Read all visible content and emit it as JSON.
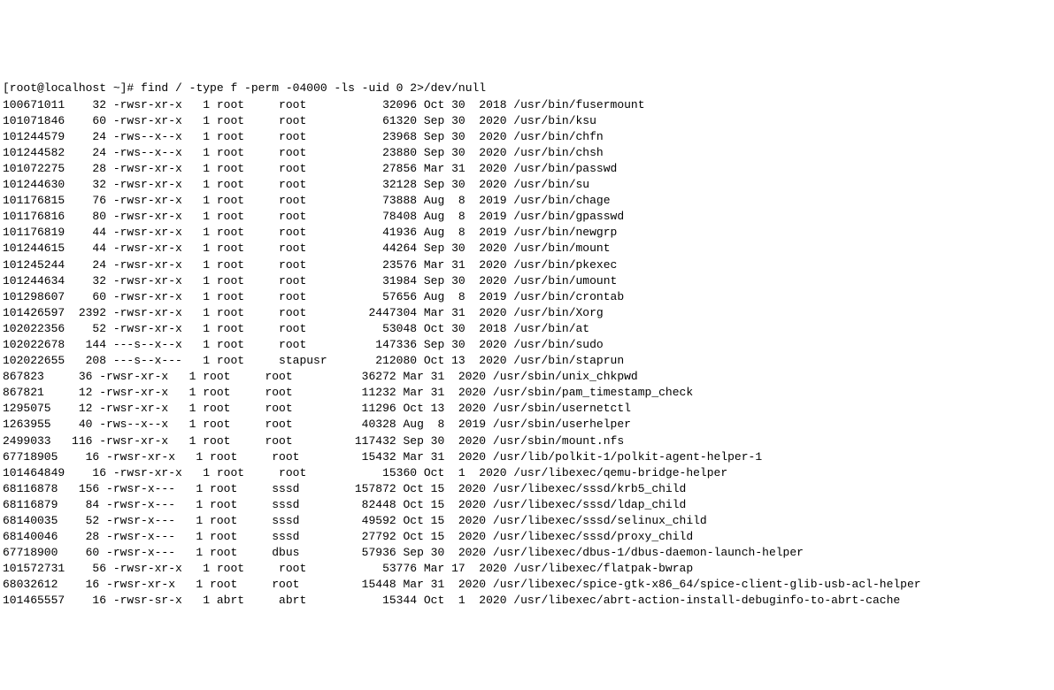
{
  "prompt": "[root@localhost ~]# ",
  "command": "find / -type f -perm -04000 -ls -uid 0 2>/dev/null",
  "rows": [
    {
      "inode": "100671011",
      "blocks": "32",
      "perm": "-rwsr-xr-x",
      "links": "1",
      "user": "root",
      "group": "root",
      "size": "32096",
      "month": "Oct",
      "day": "30",
      "year": "2018",
      "path": "/usr/bin/fusermount"
    },
    {
      "inode": "101071846",
      "blocks": "60",
      "perm": "-rwsr-xr-x",
      "links": "1",
      "user": "root",
      "group": "root",
      "size": "61320",
      "month": "Sep",
      "day": "30",
      "year": "2020",
      "path": "/usr/bin/ksu"
    },
    {
      "inode": "101244579",
      "blocks": "24",
      "perm": "-rws--x--x",
      "links": "1",
      "user": "root",
      "group": "root",
      "size": "23968",
      "month": "Sep",
      "day": "30",
      "year": "2020",
      "path": "/usr/bin/chfn"
    },
    {
      "inode": "101244582",
      "blocks": "24",
      "perm": "-rws--x--x",
      "links": "1",
      "user": "root",
      "group": "root",
      "size": "23880",
      "month": "Sep",
      "day": "30",
      "year": "2020",
      "path": "/usr/bin/chsh"
    },
    {
      "inode": "101072275",
      "blocks": "28",
      "perm": "-rwsr-xr-x",
      "links": "1",
      "user": "root",
      "group": "root",
      "size": "27856",
      "month": "Mar",
      "day": "31",
      "year": "2020",
      "path": "/usr/bin/passwd"
    },
    {
      "inode": "101244630",
      "blocks": "32",
      "perm": "-rwsr-xr-x",
      "links": "1",
      "user": "root",
      "group": "root",
      "size": "32128",
      "month": "Sep",
      "day": "30",
      "year": "2020",
      "path": "/usr/bin/su"
    },
    {
      "inode": "101176815",
      "blocks": "76",
      "perm": "-rwsr-xr-x",
      "links": "1",
      "user": "root",
      "group": "root",
      "size": "73888",
      "month": "Aug",
      "day": "8",
      "year": "2019",
      "path": "/usr/bin/chage"
    },
    {
      "inode": "101176816",
      "blocks": "80",
      "perm": "-rwsr-xr-x",
      "links": "1",
      "user": "root",
      "group": "root",
      "size": "78408",
      "month": "Aug",
      "day": "8",
      "year": "2019",
      "path": "/usr/bin/gpasswd"
    },
    {
      "inode": "101176819",
      "blocks": "44",
      "perm": "-rwsr-xr-x",
      "links": "1",
      "user": "root",
      "group": "root",
      "size": "41936",
      "month": "Aug",
      "day": "8",
      "year": "2019",
      "path": "/usr/bin/newgrp"
    },
    {
      "inode": "101244615",
      "blocks": "44",
      "perm": "-rwsr-xr-x",
      "links": "1",
      "user": "root",
      "group": "root",
      "size": "44264",
      "month": "Sep",
      "day": "30",
      "year": "2020",
      "path": "/usr/bin/mount"
    },
    {
      "inode": "101245244",
      "blocks": "24",
      "perm": "-rwsr-xr-x",
      "links": "1",
      "user": "root",
      "group": "root",
      "size": "23576",
      "month": "Mar",
      "day": "31",
      "year": "2020",
      "path": "/usr/bin/pkexec"
    },
    {
      "inode": "101244634",
      "blocks": "32",
      "perm": "-rwsr-xr-x",
      "links": "1",
      "user": "root",
      "group": "root",
      "size": "31984",
      "month": "Sep",
      "day": "30",
      "year": "2020",
      "path": "/usr/bin/umount"
    },
    {
      "inode": "101298607",
      "blocks": "60",
      "perm": "-rwsr-xr-x",
      "links": "1",
      "user": "root",
      "group": "root",
      "size": "57656",
      "month": "Aug",
      "day": "8",
      "year": "2019",
      "path": "/usr/bin/crontab"
    },
    {
      "inode": "101426597",
      "blocks": "2392",
      "perm": "-rwsr-xr-x",
      "links": "1",
      "user": "root",
      "group": "root",
      "size": "2447304",
      "month": "Mar",
      "day": "31",
      "year": "2020",
      "path": "/usr/bin/Xorg"
    },
    {
      "inode": "102022356",
      "blocks": "52",
      "perm": "-rwsr-xr-x",
      "links": "1",
      "user": "root",
      "group": "root",
      "size": "53048",
      "month": "Oct",
      "day": "30",
      "year": "2018",
      "path": "/usr/bin/at"
    },
    {
      "inode": "102022678",
      "blocks": "144",
      "perm": "---s--x--x",
      "links": "1",
      "user": "root",
      "group": "root",
      "size": "147336",
      "month": "Sep",
      "day": "30",
      "year": "2020",
      "path": "/usr/bin/sudo"
    },
    {
      "inode": "102022655",
      "blocks": "208",
      "perm": "---s--x---",
      "links": "1",
      "user": "root",
      "group": "stapusr",
      "size": "212080",
      "month": "Oct",
      "day": "13",
      "year": "2020",
      "path": "/usr/bin/staprun"
    },
    {
      "inode": "867823",
      "blocks": "36",
      "perm": "-rwsr-xr-x",
      "links": "1",
      "user": "root",
      "group": "root",
      "size": "36272",
      "month": "Mar",
      "day": "31",
      "year": "2020",
      "path": "/usr/sbin/unix_chkpwd"
    },
    {
      "inode": "867821",
      "blocks": "12",
      "perm": "-rwsr-xr-x",
      "links": "1",
      "user": "root",
      "group": "root",
      "size": "11232",
      "month": "Mar",
      "day": "31",
      "year": "2020",
      "path": "/usr/sbin/pam_timestamp_check"
    },
    {
      "inode": "1295075",
      "blocks": "12",
      "perm": "-rwsr-xr-x",
      "links": "1",
      "user": "root",
      "group": "root",
      "size": "11296",
      "month": "Oct",
      "day": "13",
      "year": "2020",
      "path": "/usr/sbin/usernetctl"
    },
    {
      "inode": "1263955",
      "blocks": "40",
      "perm": "-rws--x--x",
      "links": "1",
      "user": "root",
      "group": "root",
      "size": "40328",
      "month": "Aug",
      "day": "8",
      "year": "2019",
      "path": "/usr/sbin/userhelper"
    },
    {
      "inode": "2499033",
      "blocks": "116",
      "perm": "-rwsr-xr-x",
      "links": "1",
      "user": "root",
      "group": "root",
      "size": "117432",
      "month": "Sep",
      "day": "30",
      "year": "2020",
      "path": "/usr/sbin/mount.nfs"
    },
    {
      "inode": "67718905",
      "blocks": "16",
      "perm": "-rwsr-xr-x",
      "links": "1",
      "user": "root",
      "group": "root",
      "size": "15432",
      "month": "Mar",
      "day": "31",
      "year": "2020",
      "path": "/usr/lib/polkit-1/polkit-agent-helper-1"
    },
    {
      "inode": "101464849",
      "blocks": "16",
      "perm": "-rwsr-xr-x",
      "links": "1",
      "user": "root",
      "group": "root",
      "size": "15360",
      "month": "Oct",
      "day": "1",
      "year": "2020",
      "path": "/usr/libexec/qemu-bridge-helper"
    },
    {
      "inode": "68116878",
      "blocks": "156",
      "perm": "-rwsr-x---",
      "links": "1",
      "user": "root",
      "group": "sssd",
      "size": "157872",
      "month": "Oct",
      "day": "15",
      "year": "2020",
      "path": "/usr/libexec/sssd/krb5_child"
    },
    {
      "inode": "68116879",
      "blocks": "84",
      "perm": "-rwsr-x---",
      "links": "1",
      "user": "root",
      "group": "sssd",
      "size": "82448",
      "month": "Oct",
      "day": "15",
      "year": "2020",
      "path": "/usr/libexec/sssd/ldap_child"
    },
    {
      "inode": "68140035",
      "blocks": "52",
      "perm": "-rwsr-x---",
      "links": "1",
      "user": "root",
      "group": "sssd",
      "size": "49592",
      "month": "Oct",
      "day": "15",
      "year": "2020",
      "path": "/usr/libexec/sssd/selinux_child"
    },
    {
      "inode": "68140046",
      "blocks": "28",
      "perm": "-rwsr-x---",
      "links": "1",
      "user": "root",
      "group": "sssd",
      "size": "27792",
      "month": "Oct",
      "day": "15",
      "year": "2020",
      "path": "/usr/libexec/sssd/proxy_child"
    },
    {
      "inode": "67718900",
      "blocks": "60",
      "perm": "-rwsr-x---",
      "links": "1",
      "user": "root",
      "group": "dbus",
      "size": "57936",
      "month": "Sep",
      "day": "30",
      "year": "2020",
      "path": "/usr/libexec/dbus-1/dbus-daemon-launch-helper"
    },
    {
      "inode": "101572731",
      "blocks": "56",
      "perm": "-rwsr-xr-x",
      "links": "1",
      "user": "root",
      "group": "root",
      "size": "53776",
      "month": "Mar",
      "day": "17",
      "year": "2020",
      "path": "/usr/libexec/flatpak-bwrap"
    },
    {
      "inode": "68032612",
      "blocks": "16",
      "perm": "-rwsr-xr-x",
      "links": "1",
      "user": "root",
      "group": "root",
      "size": "15448",
      "month": "Mar",
      "day": "31",
      "year": "2020",
      "path": "/usr/libexec/spice-gtk-x86_64/spice-client-glib-usb-acl-helper"
    },
    {
      "inode": "101465557",
      "blocks": "16",
      "perm": "-rwsr-sr-x",
      "links": "1",
      "user": "abrt",
      "group": "abrt",
      "size": "15344",
      "month": "Oct",
      "day": "1",
      "year": "2020",
      "path": "/usr/libexec/abrt-action-install-debuginfo-to-abrt-cache"
    }
  ]
}
